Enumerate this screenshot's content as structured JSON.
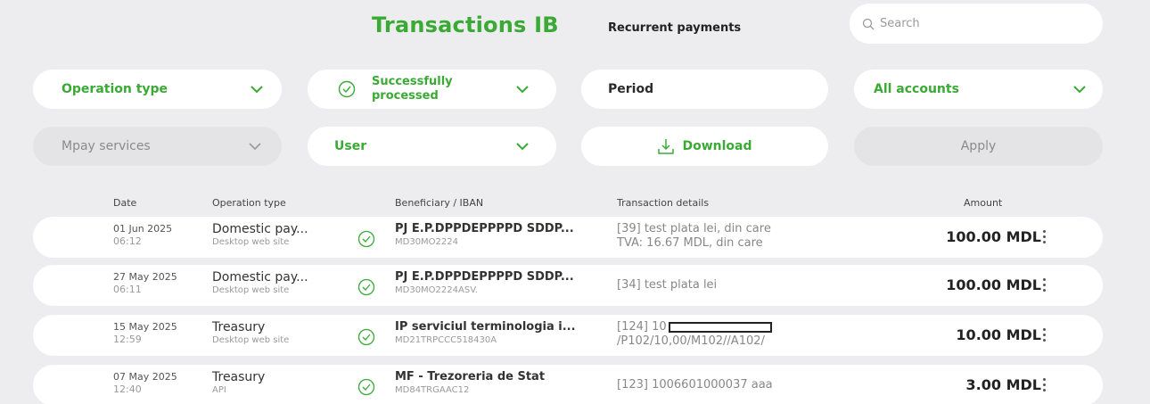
{
  "header": {
    "title": "Transactions IB",
    "recurrent_tab": "Recurrent payments",
    "search_placeholder": "Search"
  },
  "filters": {
    "operation_type": "Operation type",
    "status_line1": "Successfully",
    "status_line2": "processed",
    "period": "Period",
    "accounts": "All accounts",
    "mpay": "Mpay services",
    "user": "User",
    "download": "Download",
    "apply": "Apply"
  },
  "table": {
    "headers": {
      "date": "Date",
      "operation_type": "Operation type",
      "beneficiary": "Beneficiary / IBAN",
      "details": "Transaction details",
      "amount": "Amount"
    },
    "rows": [
      {
        "date": "01 Jun 2025",
        "time": "06:12",
        "op": "Domestic pay...",
        "channel": "Desktop web site",
        "beneficiary": "PJ E.P.DPPDEPPPPD SDDP...",
        "iban": "MD30MO2224",
        "details_line1": "[39] test plata lei, din care",
        "details_line2": "TVA: 16.67 MDL, din care",
        "amount": "100.00 MDL"
      },
      {
        "date": "27 May 2025",
        "time": "06:11",
        "op": "Domestic pay...",
        "channel": "Desktop web site",
        "beneficiary": "PJ E.P.DPPDEPPPPD SDDP...",
        "iban": "MD30MO2224ASV.",
        "details_line1": "[34] test plata lei",
        "amount": "100.00 MDL"
      },
      {
        "date": "15 May 2025",
        "time": "12:59",
        "op": "Treasury",
        "channel": "Desktop web site",
        "beneficiary": "IP serviciul terminologia i...",
        "iban": "MD21TRPCCC518430A",
        "details_line1": "[124] 10",
        "details_line2": "/P102/10,00/M102//A102/",
        "amount": "10.00 MDL"
      },
      {
        "date": "07 May 2025",
        "time": "12:40",
        "op": "Treasury",
        "channel": "API",
        "beneficiary": "MF - Trezoreria de Stat",
        "iban": "MD84TRGAAC12",
        "details_line1": "[123] 1006601000037 aaa",
        "amount": "3.00 MDL"
      }
    ]
  },
  "colors": {
    "accent_green": "#3aaa35",
    "background": "#ededf0"
  },
  "icons": [
    "search-icon",
    "check-circle-icon",
    "chevron-down-icon",
    "download-icon",
    "kebab-menu-icon"
  ]
}
